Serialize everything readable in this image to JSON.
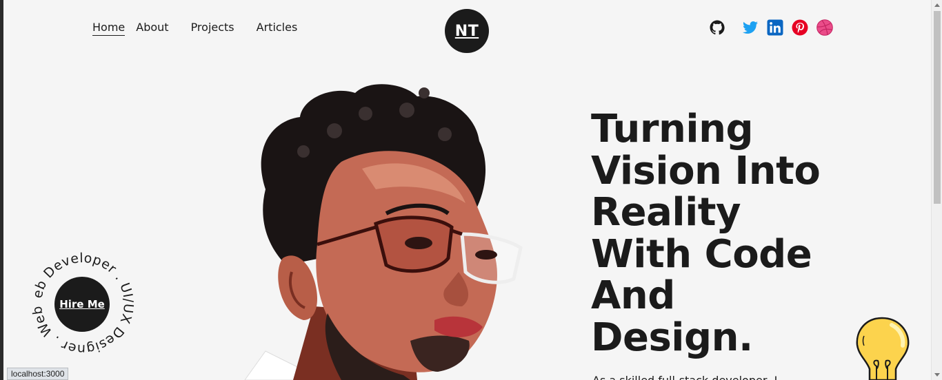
{
  "nav": {
    "links": [
      {
        "label": "Home",
        "active": true
      },
      {
        "label": "About",
        "active": false
      },
      {
        "label": "Projects",
        "active": false
      },
      {
        "label": "Articles",
        "active": false
      }
    ],
    "logo": "NT",
    "socials": [
      "github-icon",
      "twitter-icon",
      "linkedin-icon",
      "pinterest-icon",
      "dribbble-icon"
    ]
  },
  "hero": {
    "headline_lines": [
      "Turning",
      "Vision Into",
      "Reality",
      "With Code",
      "And",
      "Design."
    ],
    "intro_text": "As a skilled full-stack developer, I",
    "portrait": "developer-portrait-illustration",
    "hire_button": "Hire Me",
    "ring_text": "Web Developer . UI/UX Designer . "
  },
  "colors": {
    "background": "#f5f5f5",
    "text": "#1b1b1b",
    "twitter": "#1da1f2",
    "linkedin": "#0a66c2",
    "pinterest": "#e60023",
    "dribbble": "#ea4c89"
  },
  "status_bar": "localhost:3000"
}
